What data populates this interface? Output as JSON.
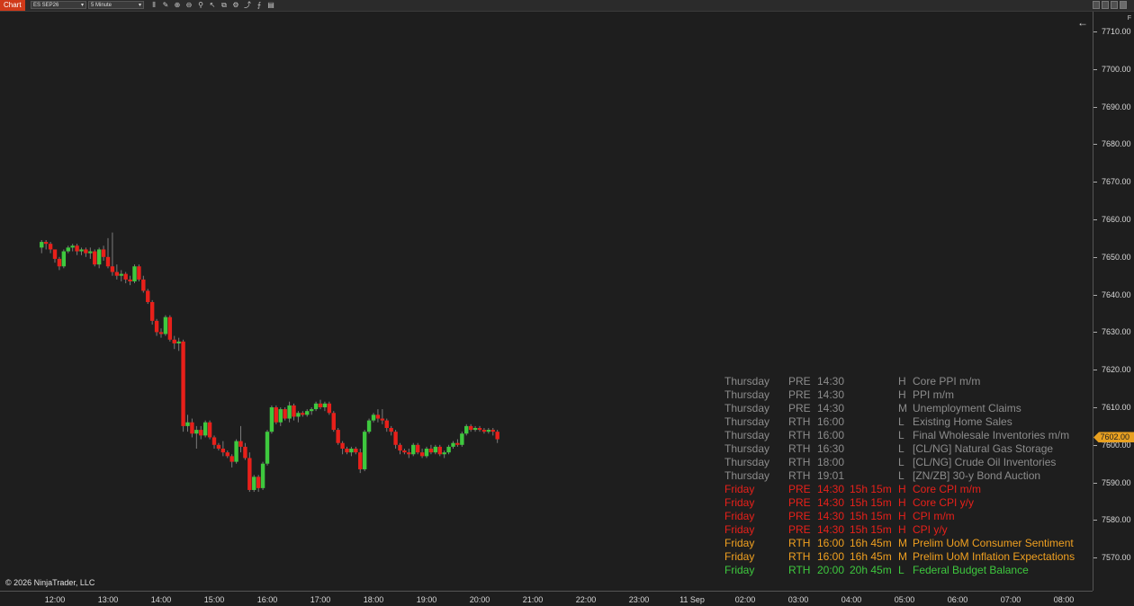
{
  "toolbar": {
    "chart_tab": "Chart",
    "instrument": "ES SEP26",
    "interval": "5 Minute"
  },
  "colors": {
    "up": "#3ec83e",
    "down": "#e8201a",
    "background": "#1e1e1e",
    "price_marker": "#e8a020"
  },
  "price_axis": {
    "ticks": [
      "7710.00",
      "7700.00",
      "7690.00",
      "7680.00",
      "7670.00",
      "7660.00",
      "7650.00",
      "7640.00",
      "7630.00",
      "7620.00",
      "7610.00",
      "7600.00",
      "7590.00",
      "7580.00",
      "7570.00"
    ],
    "current_price": "7602.00"
  },
  "time_axis": {
    "labels": [
      "12:00",
      "13:00",
      "14:00",
      "15:00",
      "16:00",
      "17:00",
      "18:00",
      "19:00",
      "20:00",
      "21:00",
      "22:00",
      "23:00",
      "11 Sep",
      "02:00",
      "03:00",
      "04:00",
      "05:00",
      "06:00",
      "07:00",
      "08:00"
    ]
  },
  "copyright": "© 2026 NinjaTrader, LLC",
  "events": [
    {
      "day": "Thursday",
      "session": "PRE",
      "time": "14:30",
      "countdown": "",
      "impact": "H",
      "name": "Core PPI m/m",
      "color": "#8c8c8c"
    },
    {
      "day": "Thursday",
      "session": "PRE",
      "time": "14:30",
      "countdown": "",
      "impact": "H",
      "name": "PPI m/m",
      "color": "#8c8c8c"
    },
    {
      "day": "Thursday",
      "session": "PRE",
      "time": "14:30",
      "countdown": "",
      "impact": "M",
      "name": "Unemployment Claims",
      "color": "#8c8c8c"
    },
    {
      "day": "Thursday",
      "session": "RTH",
      "time": "16:00",
      "countdown": "",
      "impact": "L",
      "name": "Existing Home Sales",
      "color": "#8c8c8c"
    },
    {
      "day": "Thursday",
      "session": "RTH",
      "time": "16:00",
      "countdown": "",
      "impact": "L",
      "name": "Final Wholesale Inventories m/m",
      "color": "#8c8c8c"
    },
    {
      "day": "Thursday",
      "session": "RTH",
      "time": "16:30",
      "countdown": "",
      "impact": "L",
      "name": "[CL/NG] Natural Gas Storage",
      "color": "#8c8c8c"
    },
    {
      "day": "Thursday",
      "session": "RTH",
      "time": "18:00",
      "countdown": "",
      "impact": "L",
      "name": "[CL/NG] Crude Oil Inventories",
      "color": "#8c8c8c"
    },
    {
      "day": "Thursday",
      "session": "RTH",
      "time": "19:01",
      "countdown": "",
      "impact": "L",
      "name": "[ZN/ZB] 30-y Bond Auction",
      "color": "#8c8c8c"
    },
    {
      "day": "Friday",
      "session": "PRE",
      "time": "14:30",
      "countdown": "15h 15m",
      "impact": "H",
      "name": "Core CPI m/m",
      "color": "#e8201a"
    },
    {
      "day": "Friday",
      "session": "PRE",
      "time": "14:30",
      "countdown": "15h 15m",
      "impact": "H",
      "name": "Core CPI y/y",
      "color": "#e8201a"
    },
    {
      "day": "Friday",
      "session": "PRE",
      "time": "14:30",
      "countdown": "15h 15m",
      "impact": "H",
      "name": "CPI m/m",
      "color": "#e8201a"
    },
    {
      "day": "Friday",
      "session": "PRE",
      "time": "14:30",
      "countdown": "15h 15m",
      "impact": "H",
      "name": "CPI y/y",
      "color": "#e8201a"
    },
    {
      "day": "Friday",
      "session": "RTH",
      "time": "16:00",
      "countdown": "16h 45m",
      "impact": "M",
      "name": "Prelim UoM Consumer Sentiment",
      "color": "#f0a020"
    },
    {
      "day": "Friday",
      "session": "RTH",
      "time": "16:00",
      "countdown": "16h 45m",
      "impact": "M",
      "name": "Prelim UoM Inflation Expectations",
      "color": "#f0a020"
    },
    {
      "day": "Friday",
      "session": "RTH",
      "time": "20:00",
      "countdown": "20h 45m",
      "impact": "L",
      "name": "Federal Budget Balance",
      "color": "#3ec83e"
    }
  ],
  "chart_data": {
    "type": "candlestick",
    "instrument": "ES SEP26",
    "interval": "5 Minute",
    "ylim": [
      7565,
      7715
    ],
    "xlabel": "",
    "ylabel": "",
    "x_range": [
      "11:50",
      "08:30"
    ],
    "bars": [
      {
        "t": "11:45",
        "o": 7652.5,
        "h": 7654.5,
        "l": 7651.0,
        "c": 7654.0
      },
      {
        "t": "11:50",
        "o": 7654.0,
        "h": 7654.5,
        "l": 7652.0,
        "c": 7653.5
      },
      {
        "t": "11:55",
        "o": 7653.5,
        "h": 7654.0,
        "l": 7651.0,
        "c": 7652.0
      },
      {
        "t": "12:00",
        "o": 7652.0,
        "h": 7652.0,
        "l": 7648.5,
        "c": 7649.5
      },
      {
        "t": "12:05",
        "o": 7649.5,
        "h": 7650.0,
        "l": 7646.5,
        "c": 7647.5
      },
      {
        "t": "12:10",
        "o": 7647.5,
        "h": 7652.0,
        "l": 7647.0,
        "c": 7651.5
      },
      {
        "t": "12:15",
        "o": 7651.5,
        "h": 7653.0,
        "l": 7651.0,
        "c": 7652.5
      },
      {
        "t": "12:20",
        "o": 7652.5,
        "h": 7653.5,
        "l": 7651.5,
        "c": 7653.0
      },
      {
        "t": "12:25",
        "o": 7653.0,
        "h": 7653.5,
        "l": 7650.5,
        "c": 7651.5
      },
      {
        "t": "12:30",
        "o": 7651.5,
        "h": 7652.5,
        "l": 7650.5,
        "c": 7652.0
      },
      {
        "t": "12:35",
        "o": 7652.0,
        "h": 7652.5,
        "l": 7650.0,
        "c": 7651.0
      },
      {
        "t": "12:40",
        "o": 7651.0,
        "h": 7652.5,
        "l": 7649.5,
        "c": 7651.5
      },
      {
        "t": "12:45",
        "o": 7651.5,
        "h": 7652.0,
        "l": 7647.5,
        "c": 7648.0
      },
      {
        "t": "12:50",
        "o": 7648.0,
        "h": 7652.5,
        "l": 7647.0,
        "c": 7652.0
      },
      {
        "t": "12:55",
        "o": 7652.0,
        "h": 7653.0,
        "l": 7649.0,
        "c": 7650.0
      },
      {
        "t": "13:00",
        "o": 7650.0,
        "h": 7655.0,
        "l": 7647.0,
        "c": 7647.5
      },
      {
        "t": "13:05",
        "o": 7647.5,
        "h": 7656.5,
        "l": 7645.0,
        "c": 7646.0
      },
      {
        "t": "13:10",
        "o": 7646.0,
        "h": 7648.0,
        "l": 7644.0,
        "c": 7645.0
      },
      {
        "t": "13:15",
        "o": 7645.0,
        "h": 7646.5,
        "l": 7643.5,
        "c": 7645.5
      },
      {
        "t": "13:20",
        "o": 7645.5,
        "h": 7646.0,
        "l": 7643.0,
        "c": 7644.0
      },
      {
        "t": "13:25",
        "o": 7644.0,
        "h": 7645.0,
        "l": 7642.5,
        "c": 7643.5
      },
      {
        "t": "13:30",
        "o": 7643.5,
        "h": 7648.0,
        "l": 7643.0,
        "c": 7647.5
      },
      {
        "t": "13:35",
        "o": 7647.5,
        "h": 7648.0,
        "l": 7643.5,
        "c": 7644.0
      },
      {
        "t": "13:40",
        "o": 7644.0,
        "h": 7645.0,
        "l": 7640.5,
        "c": 7641.0
      },
      {
        "t": "13:45",
        "o": 7641.0,
        "h": 7641.5,
        "l": 7637.5,
        "c": 7638.0
      },
      {
        "t": "13:50",
        "o": 7638.0,
        "h": 7638.5,
        "l": 7632.0,
        "c": 7633.0
      },
      {
        "t": "13:55",
        "o": 7633.0,
        "h": 7633.5,
        "l": 7629.0,
        "c": 7630.0
      },
      {
        "t": "14:00",
        "o": 7630.0,
        "h": 7631.0,
        "l": 7628.5,
        "c": 7629.5
      },
      {
        "t": "14:05",
        "o": 7629.5,
        "h": 7634.5,
        "l": 7629.0,
        "c": 7634.0
      },
      {
        "t": "14:10",
        "o": 7634.0,
        "h": 7634.5,
        "l": 7627.5,
        "c": 7628.0
      },
      {
        "t": "14:15",
        "o": 7628.0,
        "h": 7629.0,
        "l": 7625.5,
        "c": 7627.0
      },
      {
        "t": "14:20",
        "o": 7627.0,
        "h": 7628.5,
        "l": 7625.0,
        "c": 7627.5
      },
      {
        "t": "14:25",
        "o": 7627.5,
        "h": 7628.0,
        "l": 7603.5,
        "c": 7605.0
      },
      {
        "t": "14:30",
        "o": 7605.0,
        "h": 7608.0,
        "l": 7603.5,
        "c": 7606.0
      },
      {
        "t": "14:35",
        "o": 7606.0,
        "h": 7607.0,
        "l": 7602.0,
        "c": 7603.0
      },
      {
        "t": "14:40",
        "o": 7603.0,
        "h": 7605.0,
        "l": 7599.0,
        "c": 7604.0
      },
      {
        "t": "14:45",
        "o": 7604.0,
        "h": 7605.0,
        "l": 7601.5,
        "c": 7602.5
      },
      {
        "t": "14:50",
        "o": 7602.5,
        "h": 7606.5,
        "l": 7602.0,
        "c": 7606.0
      },
      {
        "t": "14:55",
        "o": 7606.0,
        "h": 7606.5,
        "l": 7601.5,
        "c": 7602.0
      },
      {
        "t": "15:00",
        "o": 7602.0,
        "h": 7602.5,
        "l": 7599.0,
        "c": 7600.0
      },
      {
        "t": "15:05",
        "o": 7600.0,
        "h": 7600.5,
        "l": 7598.5,
        "c": 7599.0
      },
      {
        "t": "15:10",
        "o": 7599.0,
        "h": 7601.0,
        "l": 7597.0,
        "c": 7598.0
      },
      {
        "t": "15:15",
        "o": 7598.0,
        "h": 7598.5,
        "l": 7596.5,
        "c": 7597.0
      },
      {
        "t": "15:20",
        "o": 7597.0,
        "h": 7597.5,
        "l": 7594.0,
        "c": 7595.5
      },
      {
        "t": "15:25",
        "o": 7595.5,
        "h": 7601.5,
        "l": 7595.0,
        "c": 7601.0
      },
      {
        "t": "15:30",
        "o": 7601.0,
        "h": 7605.0,
        "l": 7598.0,
        "c": 7599.5
      },
      {
        "t": "15:35",
        "o": 7599.5,
        "h": 7600.5,
        "l": 7596.0,
        "c": 7596.5
      },
      {
        "t": "15:40",
        "o": 7596.5,
        "h": 7598.0,
        "l": 7587.5,
        "c": 7588.0
      },
      {
        "t": "15:45",
        "o": 7588.0,
        "h": 7592.0,
        "l": 7587.5,
        "c": 7591.5
      },
      {
        "t": "15:50",
        "o": 7591.5,
        "h": 7592.0,
        "l": 7587.5,
        "c": 7588.5
      },
      {
        "t": "15:55",
        "o": 7588.5,
        "h": 7595.5,
        "l": 7588.0,
        "c": 7595.0
      },
      {
        "t": "16:00",
        "o": 7595.0,
        "h": 7604.0,
        "l": 7594.5,
        "c": 7603.5
      },
      {
        "t": "16:05",
        "o": 7603.5,
        "h": 7610.5,
        "l": 7603.0,
        "c": 7610.0
      },
      {
        "t": "16:10",
        "o": 7610.0,
        "h": 7610.5,
        "l": 7605.5,
        "c": 7606.0
      },
      {
        "t": "16:15",
        "o": 7606.0,
        "h": 7610.0,
        "l": 7605.0,
        "c": 7609.5
      },
      {
        "t": "16:20",
        "o": 7609.5,
        "h": 7610.0,
        "l": 7606.5,
        "c": 7607.0
      },
      {
        "t": "16:25",
        "o": 7607.0,
        "h": 7611.5,
        "l": 7606.0,
        "c": 7610.5
      },
      {
        "t": "16:30",
        "o": 7610.5,
        "h": 7611.0,
        "l": 7606.5,
        "c": 7607.5
      },
      {
        "t": "16:35",
        "o": 7607.5,
        "h": 7609.0,
        "l": 7606.0,
        "c": 7608.5
      },
      {
        "t": "16:40",
        "o": 7608.5,
        "h": 7609.0,
        "l": 7607.5,
        "c": 7608.0
      },
      {
        "t": "16:45",
        "o": 7608.0,
        "h": 7609.5,
        "l": 7607.5,
        "c": 7609.0
      },
      {
        "t": "16:50",
        "o": 7609.0,
        "h": 7610.0,
        "l": 7608.0,
        "c": 7609.5
      },
      {
        "t": "16:55",
        "o": 7609.5,
        "h": 7611.5,
        "l": 7609.0,
        "c": 7611.0
      },
      {
        "t": "17:00",
        "o": 7611.0,
        "h": 7612.0,
        "l": 7609.5,
        "c": 7610.0
      },
      {
        "t": "17:05",
        "o": 7610.0,
        "h": 7611.5,
        "l": 7609.0,
        "c": 7611.0
      },
      {
        "t": "17:10",
        "o": 7611.0,
        "h": 7611.5,
        "l": 7608.0,
        "c": 7608.5
      },
      {
        "t": "17:15",
        "o": 7608.5,
        "h": 7609.0,
        "l": 7603.5,
        "c": 7604.0
      },
      {
        "t": "17:20",
        "o": 7604.0,
        "h": 7604.5,
        "l": 7600.0,
        "c": 7600.5
      },
      {
        "t": "17:25",
        "o": 7600.5,
        "h": 7601.0,
        "l": 7597.5,
        "c": 7599.0
      },
      {
        "t": "17:30",
        "o": 7599.0,
        "h": 7599.5,
        "l": 7597.5,
        "c": 7598.0
      },
      {
        "t": "17:35",
        "o": 7598.0,
        "h": 7599.5,
        "l": 7597.0,
        "c": 7599.0
      },
      {
        "t": "17:40",
        "o": 7599.0,
        "h": 7599.5,
        "l": 7597.5,
        "c": 7598.0
      },
      {
        "t": "17:45",
        "o": 7598.0,
        "h": 7599.0,
        "l": 7592.5,
        "c": 7593.5
      },
      {
        "t": "17:50",
        "o": 7593.5,
        "h": 7604.0,
        "l": 7593.0,
        "c": 7603.5
      },
      {
        "t": "17:55",
        "o": 7603.5,
        "h": 7607.0,
        "l": 7603.0,
        "c": 7606.5
      },
      {
        "t": "18:00",
        "o": 7606.5,
        "h": 7608.5,
        "l": 7606.0,
        "c": 7608.0
      },
      {
        "t": "18:05",
        "o": 7608.0,
        "h": 7609.5,
        "l": 7606.0,
        "c": 7607.0
      },
      {
        "t": "18:10",
        "o": 7607.0,
        "h": 7609.5,
        "l": 7605.5,
        "c": 7606.5
      },
      {
        "t": "18:15",
        "o": 7606.5,
        "h": 7607.0,
        "l": 7603.5,
        "c": 7604.5
      },
      {
        "t": "18:20",
        "o": 7604.5,
        "h": 7605.0,
        "l": 7602.5,
        "c": 7603.5
      },
      {
        "t": "18:25",
        "o": 7603.5,
        "h": 7604.0,
        "l": 7599.0,
        "c": 7600.0
      },
      {
        "t": "18:30",
        "o": 7600.0,
        "h": 7600.5,
        "l": 7597.5,
        "c": 7598.5
      },
      {
        "t": "18:35",
        "o": 7598.5,
        "h": 7599.0,
        "l": 7597.5,
        "c": 7598.0
      },
      {
        "t": "18:40",
        "o": 7598.0,
        "h": 7599.0,
        "l": 7596.5,
        "c": 7597.5
      },
      {
        "t": "18:45",
        "o": 7597.5,
        "h": 7600.5,
        "l": 7597.0,
        "c": 7600.0
      },
      {
        "t": "18:50",
        "o": 7600.0,
        "h": 7600.5,
        "l": 7597.5,
        "c": 7598.0
      },
      {
        "t": "18:55",
        "o": 7598.0,
        "h": 7599.0,
        "l": 7596.5,
        "c": 7597.0
      },
      {
        "t": "19:00",
        "o": 7597.0,
        "h": 7599.5,
        "l": 7596.5,
        "c": 7599.0
      },
      {
        "t": "19:05",
        "o": 7599.0,
        "h": 7600.0,
        "l": 7597.5,
        "c": 7598.0
      },
      {
        "t": "19:10",
        "o": 7598.0,
        "h": 7600.0,
        "l": 7597.5,
        "c": 7599.5
      },
      {
        "t": "19:15",
        "o": 7599.5,
        "h": 7600.0,
        "l": 7597.0,
        "c": 7597.5
      },
      {
        "t": "19:20",
        "o": 7597.5,
        "h": 7598.5,
        "l": 7596.5,
        "c": 7598.0
      },
      {
        "t": "19:25",
        "o": 7598.0,
        "h": 7600.0,
        "l": 7597.5,
        "c": 7599.5
      },
      {
        "t": "19:30",
        "o": 7599.5,
        "h": 7601.0,
        "l": 7599.0,
        "c": 7600.5
      },
      {
        "t": "19:35",
        "o": 7600.5,
        "h": 7601.5,
        "l": 7599.5,
        "c": 7600.0
      },
      {
        "t": "19:40",
        "o": 7600.0,
        "h": 7603.5,
        "l": 7599.5,
        "c": 7603.0
      },
      {
        "t": "19:45",
        "o": 7603.0,
        "h": 7605.5,
        "l": 7602.5,
        "c": 7605.0
      },
      {
        "t": "19:50",
        "o": 7605.0,
        "h": 7605.5,
        "l": 7603.5,
        "c": 7604.0
      },
      {
        "t": "19:55",
        "o": 7604.0,
        "h": 7605.0,
        "l": 7603.5,
        "c": 7604.5
      },
      {
        "t": "20:00",
        "o": 7604.5,
        "h": 7605.0,
        "l": 7603.5,
        "c": 7604.0
      },
      {
        "t": "20:05",
        "o": 7604.0,
        "h": 7604.5,
        "l": 7603.0,
        "c": 7603.5
      },
      {
        "t": "20:10",
        "o": 7603.5,
        "h": 7604.5,
        "l": 7603.0,
        "c": 7604.0
      },
      {
        "t": "20:15",
        "o": 7604.0,
        "h": 7604.5,
        "l": 7602.5,
        "c": 7603.5
      },
      {
        "t": "20:20",
        "o": 7603.5,
        "h": 7604.0,
        "l": 7600.5,
        "c": 7601.5
      }
    ]
  }
}
